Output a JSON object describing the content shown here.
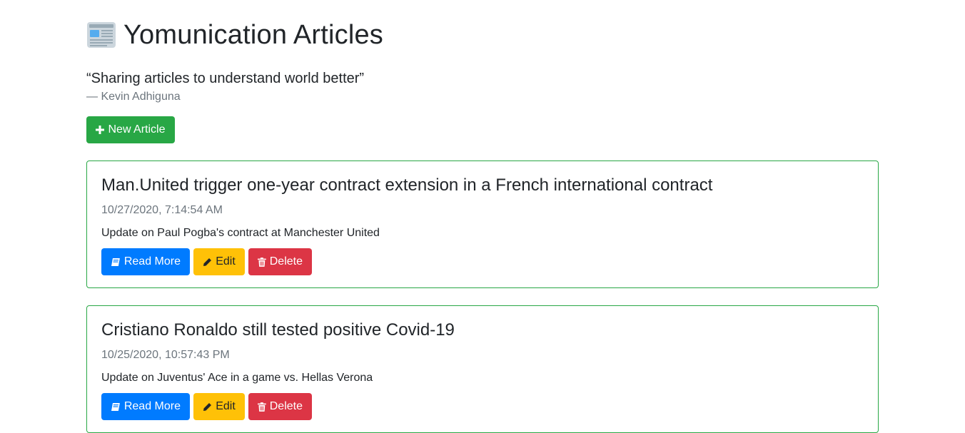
{
  "header": {
    "title": "Yomunication Articles",
    "icon": "newspaper-icon"
  },
  "quote": {
    "text": "“Sharing articles to understand world better”",
    "author": "— Kevin Adhiguna"
  },
  "new_article_button": {
    "label": "New Article",
    "icon": "plus-icon"
  },
  "articles": [
    {
      "title": "Man.United trigger one-year contract extension in a French international contract",
      "date": "10/27/2020, 7:14:54 AM",
      "description": "Update on Paul Pogba's contract at Manchester United",
      "actions": {
        "read_more": "Read More",
        "edit": "Edit",
        "delete": "Delete"
      }
    },
    {
      "title": "Cristiano Ronaldo still tested positive Covid-19",
      "date": "10/25/2020, 10:57:43 PM",
      "description": "Update on Juventus' Ace in a game vs. Hellas Verona",
      "actions": {
        "read_more": "Read More",
        "edit": "Edit",
        "delete": "Delete"
      }
    }
  ],
  "colors": {
    "success": "#28a745",
    "primary": "#007bff",
    "warning": "#ffc107",
    "danger": "#dc3545",
    "muted": "#6c757d"
  }
}
